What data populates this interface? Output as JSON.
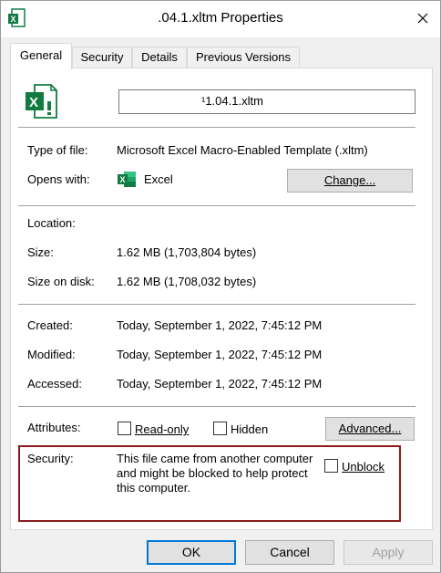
{
  "window": {
    "title": ".04.1.xltm Properties"
  },
  "tabs": [
    {
      "label": "General",
      "active": true
    },
    {
      "label": "Security",
      "active": false
    },
    {
      "label": "Details",
      "active": false
    },
    {
      "label": "Previous Versions",
      "active": false
    }
  ],
  "general": {
    "filename": "¹1.04.1.xltm",
    "type_label": "Type of file:",
    "type_value": "Microsoft Excel Macro-Enabled Template (.xltm)",
    "opens_label": "Opens with:",
    "opens_value": "Excel",
    "change_button": "Change...",
    "location_label": "Location:",
    "location_value": "",
    "size_label": "Size:",
    "size_value": "1.62 MB (1,703,804 bytes)",
    "size_on_disk_label": "Size on disk:",
    "size_on_disk_value": "1.62 MB (1,708,032 bytes)",
    "created_label": "Created:",
    "created_value": "Today, September 1, 2022, 7:45:12 PM",
    "modified_label": "Modified:",
    "modified_value": "Today, September 1, 2022, 7:45:12 PM",
    "accessed_label": "Accessed:",
    "accessed_value": "Today, September 1, 2022, 7:45:12 PM",
    "attributes_label": "Attributes:",
    "readonly_label": "Read-only",
    "hidden_label": "Hidden",
    "advanced_button": "Advanced...",
    "security_label": "Security:",
    "security_text_1": "This file came from another computer",
    "security_text_2": "and might be blocked to help protect",
    "security_text_3": "this computer.",
    "unblock_label": "Unblock"
  },
  "footer": {
    "ok": "OK",
    "cancel": "Cancel",
    "apply": "Apply"
  },
  "colors": {
    "excel_green": "#107c41",
    "highlight_frame": "#8b1a1a",
    "focus_blue": "#0078d7"
  }
}
